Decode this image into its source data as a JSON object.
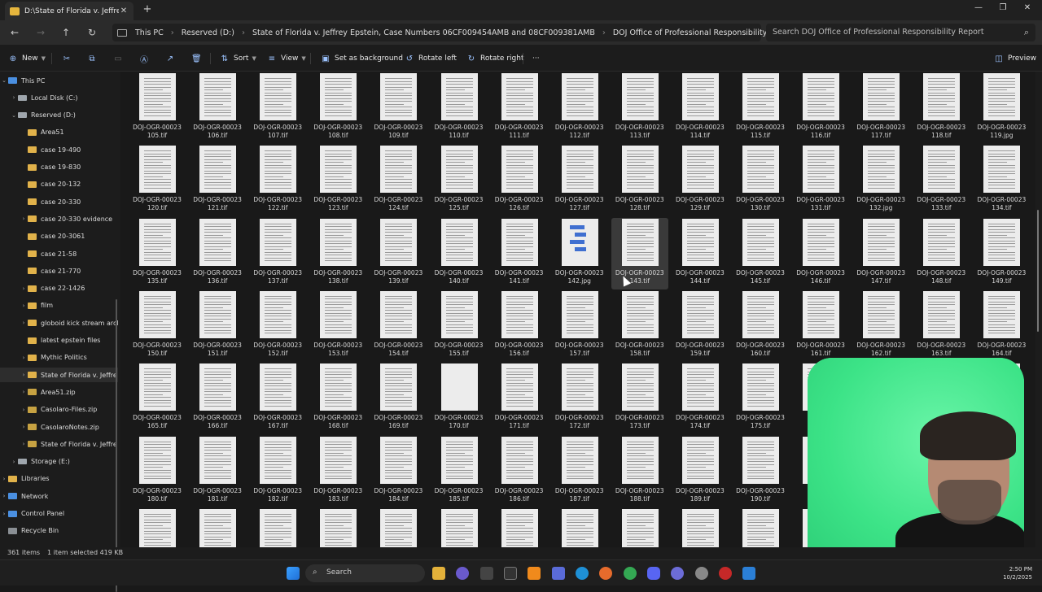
{
  "window": {
    "tab_title": "D:\\State of Florida v. Jeffrey E",
    "new_tab": "+",
    "minimize": "—",
    "maximize": "❐",
    "close": "✕"
  },
  "nav": {
    "breadcrumbs": [
      "This PC",
      "Reserved (D:)",
      "State of Florida v. Jeffrey Epstein, Case Numbers 06CF009454AMB and 08CF009381AMB",
      "DOJ Office of Professional Responsibility Report"
    ],
    "search_placeholder": "Search DOJ Office of Professional Responsibility Report"
  },
  "commands": {
    "new": "New",
    "sort": "Sort",
    "view": "View",
    "set_background": "Set as background",
    "rotate_left": "Rotate left",
    "rotate_right": "Rotate right",
    "more": "···",
    "preview": "Preview"
  },
  "tree": [
    {
      "label": "This PC",
      "icon": "pc",
      "indent": 1,
      "chev": "v"
    },
    {
      "label": "Local Disk (C:)",
      "icon": "drive",
      "indent": 2,
      "chev": ">"
    },
    {
      "label": "Reserved (D:)",
      "icon": "drive",
      "indent": 2,
      "chev": "v"
    },
    {
      "label": "Area51",
      "icon": "folder",
      "indent": 3,
      "chev": ""
    },
    {
      "label": "case 19-490",
      "icon": "folder",
      "indent": 3,
      "chev": ""
    },
    {
      "label": "case 19-830",
      "icon": "folder",
      "indent": 3,
      "chev": ""
    },
    {
      "label": "case 20-132",
      "icon": "folder",
      "indent": 3,
      "chev": ""
    },
    {
      "label": "case 20-330",
      "icon": "folder",
      "indent": 3,
      "chev": ""
    },
    {
      "label": "case 20-330 evidence",
      "icon": "folder",
      "indent": 3,
      "chev": ">"
    },
    {
      "label": "case 20-3061",
      "icon": "folder",
      "indent": 3,
      "chev": ""
    },
    {
      "label": "case 21-58",
      "icon": "folder",
      "indent": 3,
      "chev": ""
    },
    {
      "label": "case 21-770",
      "icon": "folder",
      "indent": 3,
      "chev": ""
    },
    {
      "label": "case 22-1426",
      "icon": "folder",
      "indent": 3,
      "chev": ">"
    },
    {
      "label": "film",
      "icon": "folder",
      "indent": 3,
      "chev": ">"
    },
    {
      "label": "globoid kick stream arcl",
      "icon": "folder",
      "indent": 3,
      "chev": ">"
    },
    {
      "label": "latest epstein files",
      "icon": "folder",
      "indent": 3,
      "chev": ""
    },
    {
      "label": "Mythic Politics",
      "icon": "folder",
      "indent": 3,
      "chev": ">"
    },
    {
      "label": "State of Florida v. Jeffre",
      "icon": "folder",
      "indent": 3,
      "chev": ">",
      "selected": true
    },
    {
      "label": "Area51.zip",
      "icon": "zip",
      "indent": 3,
      "chev": ">"
    },
    {
      "label": "Casolaro-Files.zip",
      "icon": "zip",
      "indent": 3,
      "chev": ">"
    },
    {
      "label": "CasolaroNotes.zip",
      "icon": "zip",
      "indent": 3,
      "chev": ">"
    },
    {
      "label": "State of Florida v. Jeffre",
      "icon": "zip",
      "indent": 3,
      "chev": ">"
    },
    {
      "label": "Storage (E:)",
      "icon": "drive",
      "indent": 2,
      "chev": ">"
    },
    {
      "label": "Libraries",
      "icon": "folder",
      "indent": 1,
      "chev": ">"
    },
    {
      "label": "Network",
      "icon": "net",
      "indent": 1,
      "chev": ">"
    },
    {
      "label": "Control Panel",
      "icon": "cp",
      "indent": 1,
      "chev": ">"
    },
    {
      "label": "Recycle Bin",
      "icon": "bin",
      "indent": 1,
      "chev": ""
    }
  ],
  "files": {
    "prefix": "DOJ-OGR-00023",
    "rows": [
      [
        "105.tif",
        "106.tif",
        "107.tif",
        "108.tif",
        "109.tif",
        "110.tif",
        "111.tif",
        "112.tif",
        "113.tif",
        "114.tif",
        "115.tif",
        "116.tif",
        "117.tif",
        "118.tif",
        "119.jpg"
      ],
      [
        "120.tif",
        "121.tif",
        "122.tif",
        "123.tif",
        "124.tif",
        "125.tif",
        "126.tif",
        "127.tif",
        "128.tif",
        "129.tif",
        "130.tif",
        "131.tif",
        "132.jpg",
        "133.tif",
        "134.tif"
      ],
      [
        "135.tif",
        "136.tif",
        "137.tif",
        "138.tif",
        "139.tif",
        "140.tif",
        "141.tif",
        "142.jpg",
        "143.tif",
        "144.tif",
        "145.tif",
        "146.tif",
        "147.tif",
        "148.tif",
        "149.tif"
      ],
      [
        "150.tif",
        "151.tif",
        "152.tif",
        "153.tif",
        "154.tif",
        "155.tif",
        "156.tif",
        "157.tif",
        "158.tif",
        "159.tif",
        "160.tif",
        "161.tif",
        "162.tif",
        "163.tif",
        "164.tif"
      ],
      [
        "165.tif",
        "166.tif",
        "167.tif",
        "168.tif",
        "169.tif",
        "170.tif",
        "171.tif",
        "172.tif",
        "173.tif",
        "174.tif",
        "175.tif",
        "",
        "",
        "",
        ""
      ],
      [
        "180.tif",
        "181.tif",
        "182.tif",
        "183.tif",
        "184.tif",
        "185.tif",
        "186.tif",
        "187.tif",
        "188.tif",
        "189.tif",
        "190.tif",
        "",
        "",
        "",
        ""
      ],
      [
        "",
        "",
        "",
        "",
        "",
        "",
        "",
        "",
        "",
        "",
        "",
        "",
        "",
        "",
        ""
      ]
    ]
  },
  "status": {
    "items": "361 items",
    "selected": "1 item selected  419 KB"
  },
  "taskbar": {
    "search": "Search",
    "time": "2:50 PM",
    "date": "10/2/2025"
  }
}
